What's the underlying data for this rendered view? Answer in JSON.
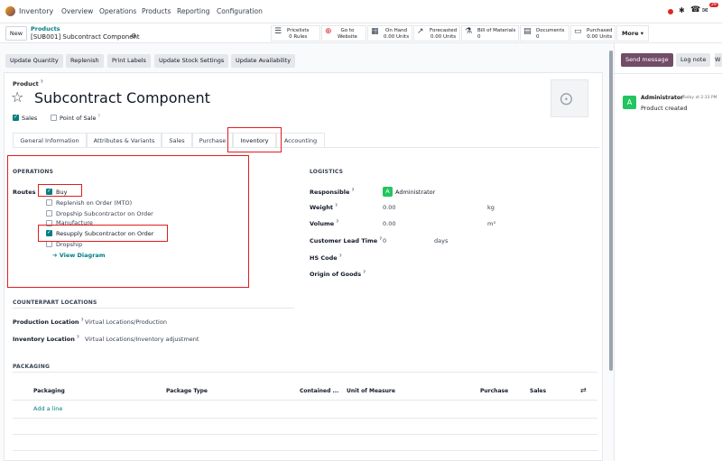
{
  "topbar": {
    "app_name": "Inventory",
    "menu": [
      "Overview",
      "Operations",
      "Products",
      "Reporting",
      "Configuration"
    ],
    "badge": "29"
  },
  "control": {
    "new_label": "New",
    "breadcrumb_parent": "Products",
    "breadcrumb_current": "[SUB001] Subcontract Component",
    "smart_buttons": [
      {
        "icon": "list-icon",
        "glyph": "☰",
        "line1": "Pricelists",
        "line2": "0 Rules"
      },
      {
        "icon": "globe-icon",
        "glyph": "⊕",
        "line1": "Go to",
        "line2": "Website"
      },
      {
        "icon": "cubes-icon",
        "glyph": "▦",
        "line1": "On Hand",
        "line2": "0.00 Units"
      },
      {
        "icon": "chart-icon",
        "glyph": "↗",
        "line1": "Forecasted",
        "line2": "0.00 Units"
      },
      {
        "icon": "flask-icon",
        "glyph": "⚗",
        "line1": "Bill of Materials",
        "line2": "0"
      },
      {
        "icon": "file-icon",
        "glyph": "▤",
        "line1": "Documents",
        "line2": "0"
      },
      {
        "icon": "credit-card-icon",
        "glyph": "▭",
        "line1": "Purchased",
        "line2": "0.00 Units"
      }
    ],
    "more_label": "More ▾"
  },
  "actions": [
    "Update Quantity",
    "Replenish",
    "Print Labels",
    "Update Stock Settings",
    "Update Availability"
  ],
  "product": {
    "type_label": "Product",
    "name": "Subcontract Component",
    "sales_label": "Sales",
    "pos_label": "Point of Sale"
  },
  "tabs": [
    "General Information",
    "Attributes & Variants",
    "Sales",
    "Purchase",
    "Inventory",
    "Accounting"
  ],
  "operations": {
    "title": "OPERATIONS",
    "routes_label": "Routes",
    "routes": [
      {
        "label": "Buy",
        "checked": true
      },
      {
        "label": "Replenish on Order (MTO)",
        "checked": false
      },
      {
        "label": "Dropship Subcontractor on Order",
        "checked": false
      },
      {
        "label": "Manufacture",
        "checked": false
      },
      {
        "label": "Resupply Subcontractor on Order",
        "checked": true
      },
      {
        "label": "Dropship",
        "checked": false
      }
    ],
    "view_diagram": "➔ View Diagram"
  },
  "logistics": {
    "title": "LOGISTICS",
    "responsible_label": "Responsible",
    "responsible_avatar": "A",
    "responsible_value": "Administrator",
    "weight_label": "Weight",
    "weight_value": "0.00",
    "weight_unit": "kg",
    "volume_label": "Volume",
    "volume_value": "0.00",
    "volume_unit": "m³",
    "lead_label": "Customer Lead Time",
    "lead_value": "0",
    "lead_unit": "days",
    "hs_label": "HS Code",
    "origin_label": "Origin of Goods"
  },
  "counterpart": {
    "title": "COUNTERPART LOCATIONS",
    "production_label": "Production Location",
    "production_value": "Virtual Locations/Production",
    "inventory_label": "Inventory Location",
    "inventory_value": "Virtual Locations/Inventory adjustment"
  },
  "packaging": {
    "title": "PACKAGING",
    "columns": [
      "Packaging",
      "Package Type",
      "Contained ...",
      "Unit of Measure",
      "Purchase",
      "Sales"
    ],
    "add_line": "Add a line"
  },
  "chatter": {
    "send_label": "Send message",
    "log_label": "Log note",
    "author": "Administrator",
    "time": "Today at 2:33 PM",
    "message": "Product created",
    "avatar": "A"
  },
  "colors": {
    "accent": "#714b67",
    "teal": "#017e84",
    "avatar_green": "#22c55e",
    "highlight": "#e11d1d"
  }
}
